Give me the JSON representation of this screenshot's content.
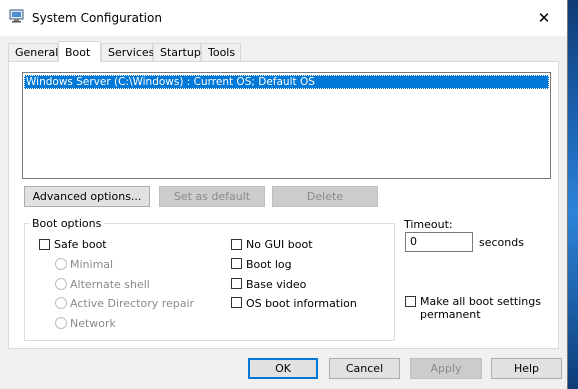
{
  "window": {
    "title": "System Configuration",
    "close_symbol": "✕"
  },
  "tabs": [
    {
      "label": "General",
      "active": false
    },
    {
      "label": "Boot",
      "active": true
    },
    {
      "label": "Services",
      "active": false
    },
    {
      "label": "Startup",
      "active": false
    },
    {
      "label": "Tools",
      "active": false
    }
  ],
  "os_list": {
    "entries": [
      "Windows Server (C:\\Windows) : Current OS; Default OS"
    ],
    "selected_index": 0
  },
  "list_buttons": {
    "advanced": "Advanced options...",
    "set_default": "Set as default",
    "delete": "Delete"
  },
  "boot_options": {
    "title": "Boot options",
    "safe_boot": {
      "label": "Safe boot",
      "checked": false
    },
    "radios": [
      {
        "label": "Minimal",
        "enabled": false
      },
      {
        "label": "Alternate shell",
        "enabled": false
      },
      {
        "label": "Active Directory repair",
        "enabled": false
      },
      {
        "label": "Network",
        "enabled": false
      }
    ],
    "right_checks": [
      {
        "label": "No GUI boot",
        "checked": false
      },
      {
        "label": "Boot log",
        "checked": false
      },
      {
        "label": "Base video",
        "checked": false
      },
      {
        "label": "OS boot information",
        "checked": false
      }
    ]
  },
  "timeout": {
    "label": "Timeout:",
    "value": "0",
    "unit": "seconds"
  },
  "make_permanent": {
    "label_line1": "Make all boot settings",
    "label_line2": "permanent",
    "checked": false
  },
  "footer": {
    "ok": "OK",
    "cancel": "Cancel",
    "apply": "Apply",
    "help": "Help"
  },
  "colors": {
    "accent": "#0078d7",
    "dialog_bg": "#f0f0f0",
    "panel_bg": "#ffffff",
    "disabled_text": "#8a8a8a"
  }
}
